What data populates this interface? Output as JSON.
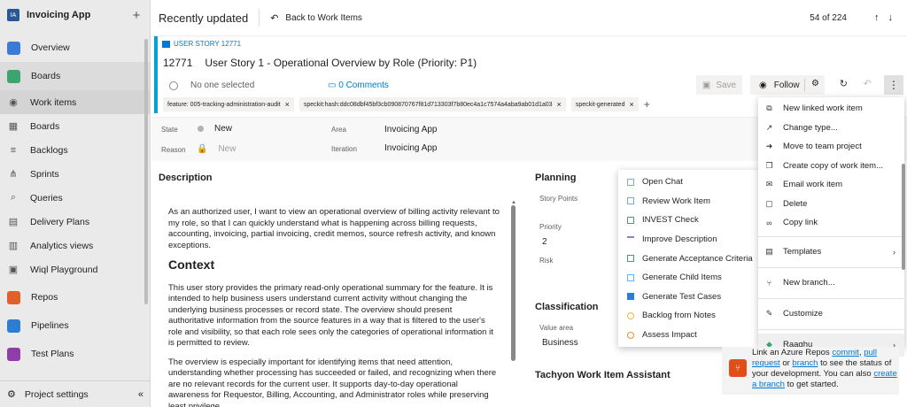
{
  "app": {
    "badge": "IA",
    "name": "Invoicing App"
  },
  "sidebar": {
    "items": [
      {
        "label": "Overview",
        "icon": "overview-icon",
        "color": "#3a7bd5"
      },
      {
        "label": "Boards",
        "icon": "boards-icon",
        "color": "#3aa56e"
      },
      {
        "label": "Work items",
        "icon": "work-items-icon"
      },
      {
        "label": "Boards",
        "icon": "board-icon"
      },
      {
        "label": "Backlogs",
        "icon": "backlogs-icon"
      },
      {
        "label": "Sprints",
        "icon": "sprints-icon"
      },
      {
        "label": "Queries",
        "icon": "queries-icon"
      },
      {
        "label": "Delivery Plans",
        "icon": "delivery-plans-icon"
      },
      {
        "label": "Analytics views",
        "icon": "analytics-icon"
      },
      {
        "label": "Wiql Playground",
        "icon": "playground-icon"
      },
      {
        "label": "Repos",
        "icon": "repos-icon",
        "color": "#e0602a"
      },
      {
        "label": "Pipelines",
        "icon": "pipelines-icon",
        "color": "#2d7dd2"
      },
      {
        "label": "Test Plans",
        "icon": "test-plans-icon",
        "color": "#8e3ea8"
      }
    ],
    "footer": {
      "label": "Project settings",
      "collapse": "«"
    }
  },
  "topbar": {
    "title": "Recently updated",
    "back_label": "Back to Work Items",
    "count": "54 of 224"
  },
  "workitem": {
    "type_label": "USER STORY 12771",
    "id": "12771",
    "title": "User Story 1 - Operational Overview by Role (Priority: P1)",
    "assigned": "No one selected",
    "comments": "0 Comments",
    "tags": [
      "feature: 005-tracking-administration-audit",
      "speckit:hash:ddc08dbf45bf3cb090870767f81d713303f7b80ec4a1c7574a4aba9ab01d1a03",
      "speckit-generated"
    ],
    "save_label": "Save",
    "follow_label": "Follow"
  },
  "fields": {
    "state_label": "State",
    "state_value": "New",
    "reason_label": "Reason",
    "reason_value": "New",
    "area_label": "Area",
    "area_value": "Invoicing App",
    "iteration_label": "Iteration",
    "iteration_value": "Invoicing App"
  },
  "description": {
    "title": "Description",
    "p1": "As an authorized user, I want to view an operational overview of billing activity relevant to my role, so that I can quickly understand what is happening across billing requests, accounting, invoicing, partial invoicing, credit memos, source refresh activity, and known exceptions.",
    "h2": "Context",
    "p2": "This user story provides the primary read-only operational summary for the feature. It is intended to help business users understand current activity without changing the underlying business processes or record state. The overview should present authoritative information from the source features in a way that is filtered to the user's role and visibility, so that each role sees only the categories of operational information it is permitted to review.",
    "p3": "The overview is especially important for identifying items that need attention, understanding whether processing has succeeded or failed, and recognizing when there are no relevant records for the current user. It supports day-to-day operational awareness for Requestor, Billing, Accounting, and Administrator roles while preserving least privilege."
  },
  "planning": {
    "title": "Planning",
    "story_points_label": "Story Points",
    "priority_label": "Priority",
    "priority_value": "2",
    "risk_label": "Risk"
  },
  "classification": {
    "title": "Classification",
    "value_area_label": "Value area",
    "value_area_value": "Business"
  },
  "tachyon": {
    "title": "Tachyon Work Item Assistant"
  },
  "ai_menu": [
    {
      "label": "Open Chat",
      "color": "#6ab0e8"
    },
    {
      "label": "Review Work Item",
      "color": "#6ab0e8"
    },
    {
      "label": "INVEST Check",
      "color": "#3aa56e"
    },
    {
      "label": "Improve Description",
      "color": "#8a7fd6"
    },
    {
      "label": "Generate Acceptance Criteria",
      "color": "#3aa56e"
    },
    {
      "label": "Generate Child Items",
      "color": "#6ab0e8"
    },
    {
      "label": "Generate Test Cases",
      "color": "#2d7dd2"
    },
    {
      "label": "Backlog from Notes",
      "color": "#e8b84a"
    },
    {
      "label": "Assess Impact",
      "color": "#e8913a"
    }
  ],
  "ctx_menu": {
    "group1": [
      {
        "label": "New linked work item",
        "icon": "new-linked-icon",
        "glyph": "⧉"
      },
      {
        "label": "Change type...",
        "icon": "change-type-icon",
        "glyph": "↗"
      },
      {
        "label": "Move to team project",
        "icon": "move-icon",
        "glyph": "➜"
      },
      {
        "label": "Create copy of work item...",
        "icon": "copy-icon",
        "glyph": "❐"
      },
      {
        "label": "Email work item",
        "icon": "email-icon",
        "glyph": "✉"
      },
      {
        "label": "Delete",
        "icon": "delete-icon",
        "glyph": "🗑"
      },
      {
        "label": "Copy link",
        "icon": "link-icon",
        "glyph": "∞"
      }
    ],
    "templates": "Templates",
    "new_branch": "New branch...",
    "customize": "Customize",
    "raaghu": "Raaghu"
  },
  "dev_panel": {
    "t1": "Link an Azure Repos ",
    "commit": "commit",
    "t2": ", ",
    "pull": "pull request",
    "t3": " or ",
    "branch": "branch",
    "t4": " to see the status of your development. You can also ",
    "create": "create a branch",
    "t5": " to get started."
  }
}
